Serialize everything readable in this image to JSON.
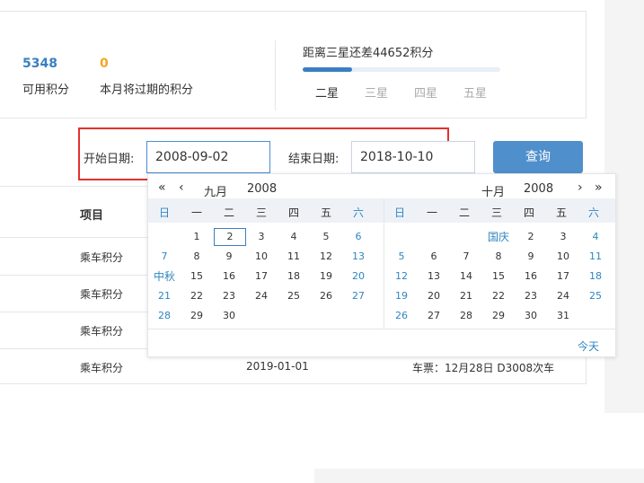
{
  "points": {
    "available_value": "5348",
    "available_label": "可用积分",
    "expiring_value": "0",
    "expiring_label": "本月将过期的积分",
    "distance_text": "距离三星还差44652积分",
    "progress_fraction": 0.25,
    "stars": [
      "二星",
      "三星",
      "四星",
      "五星"
    ],
    "current_star_index": 0
  },
  "filter": {
    "start_label": "开始日期:",
    "start_value": "2008-09-02",
    "end_label": "结束日期:",
    "end_value": "2018-10-10",
    "query_label": "查询"
  },
  "table": {
    "header_item": "项目",
    "rows": [
      {
        "item": "乘车积分",
        "date": "",
        "desc": ""
      },
      {
        "item": "乘车积分",
        "date": "",
        "desc": ""
      },
      {
        "item": "乘车积分",
        "date": "",
        "desc": ""
      },
      {
        "item": "乘车积分",
        "date": "2019-01-01",
        "desc": "车票：12月28日 D3008次车"
      }
    ]
  },
  "calendar": {
    "nav_prev_year": "«",
    "nav_prev_month": "‹",
    "nav_next_month": "›",
    "nav_next_year": "»",
    "weekdays": [
      "日",
      "一",
      "二",
      "三",
      "四",
      "五",
      "六"
    ],
    "left": {
      "month_label": "九月",
      "year_label": "2008",
      "weeks": [
        [
          "",
          "1",
          "2",
          "3",
          "4",
          "5",
          "6"
        ],
        [
          "7",
          "8",
          "9",
          "10",
          "11",
          "12",
          "13"
        ],
        [
          "中秋",
          "15",
          "16",
          "17",
          "18",
          "19",
          "20"
        ],
        [
          "21",
          "22",
          "23",
          "24",
          "25",
          "26",
          "27"
        ],
        [
          "28",
          "29",
          "30",
          "",
          "",
          "",
          ""
        ]
      ],
      "selected_day": "2"
    },
    "right": {
      "month_label": "十月",
      "year_label": "2008",
      "weeks": [
        [
          "",
          "",
          "",
          "国庆",
          "2",
          "3",
          "4"
        ],
        [
          "5",
          "6",
          "7",
          "8",
          "9",
          "10",
          "11"
        ],
        [
          "12",
          "13",
          "14",
          "15",
          "16",
          "17",
          "18"
        ],
        [
          "19",
          "20",
          "21",
          "22",
          "23",
          "24",
          "25"
        ],
        [
          "26",
          "27",
          "28",
          "29",
          "30",
          "31",
          ""
        ]
      ]
    },
    "today_label": "今天"
  },
  "colors": {
    "accent": "#3a7fc1",
    "highlight_box": "#e3312d",
    "weekend": "#2e86c1",
    "expiring": "#f5a623"
  }
}
